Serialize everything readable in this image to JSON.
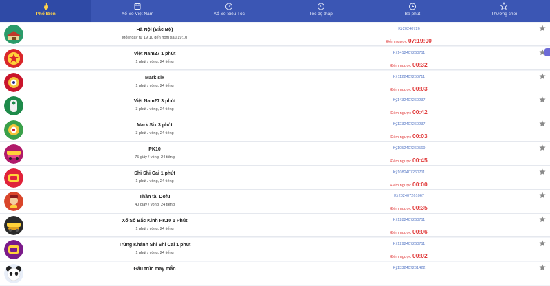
{
  "tabs": [
    {
      "label": "Phổ Biến",
      "icon": "fire-icon",
      "active": true
    },
    {
      "label": "Xổ Số Việt Nam",
      "icon": "calendar-icon",
      "active": false
    },
    {
      "label": "Xổ Số Siêu Tốc",
      "icon": "speedometer-icon",
      "active": false
    },
    {
      "label": "Tốc độ thấp",
      "icon": "gauge-icon",
      "active": false
    },
    {
      "label": "Ba phút",
      "icon": "clock-icon",
      "active": false
    },
    {
      "label": "Thường chơi",
      "icon": "star-icon",
      "active": false
    }
  ],
  "countdown_label": "Đếm ngược",
  "games": [
    {
      "name": "Hà Nội (Bắc Bộ)",
      "schedule": "Mỗi ngày từ 19:10 đến hôm sau 19:10",
      "term": "Kỳ20240726",
      "countdown": "07:19:00",
      "icon": "hanoi-temple-icon"
    },
    {
      "name": "Việt Nam27 1 phút",
      "schedule": "1 phút / vòng, 24 tiếng",
      "term": "Kỳ1412407260711",
      "countdown": "00:32",
      "icon": "vietnam27-icon"
    },
    {
      "name": "Mark six",
      "schedule": "1 phút / vòng, 24 tiếng",
      "term": "Kỳ1122407260711",
      "countdown": "00:03",
      "icon": "mark-six-ball-icon"
    },
    {
      "name": "Việt Nam27 3 phút",
      "schedule": "3 phút / vòng, 24 tiếng",
      "term": "Kỳ1432407260237",
      "countdown": "00:42",
      "icon": "vietnam27-icon"
    },
    {
      "name": "Mark Six 3 phút",
      "schedule": "3 phút / vòng, 24 tiếng",
      "term": "Kỳ1232407260237",
      "countdown": "00:03",
      "icon": "mark-six-ball-icon"
    },
    {
      "name": "PK10",
      "schedule": "75 giây / vòng, 24 tiếng",
      "term": "Kỳ1052407260569",
      "countdown": "00:45",
      "icon": "pk10-car-icon"
    },
    {
      "name": "Shi Shi Cai 1 phút",
      "schedule": "1 phút / vòng, 24 tiếng",
      "term": "Kỳ1082407260711",
      "countdown": "00:00",
      "icon": "shishicai-icon"
    },
    {
      "name": "Thần tài Dofu",
      "schedule": "40 giây / vòng, 24 tiếng",
      "term": "Kỳ202407261067",
      "countdown": "00:35",
      "icon": "god-of-wealth-icon"
    },
    {
      "name": "Xổ Số Bắc Kinh PK10 1 Phút",
      "schedule": "1 phút / vòng, 24 tiếng",
      "term": "Kỳ1282407260711",
      "countdown": "00:06",
      "icon": "pk10-car-icon"
    },
    {
      "name": "Trùng Khánh Shi Shi Cai 1 phút",
      "schedule": "1 phút / vòng, 24 tiếng",
      "term": "Kỳ1292407260711",
      "countdown": "00:02",
      "icon": "shishicai-icon"
    },
    {
      "name": "Gấu trúc may mắn",
      "schedule": "",
      "term": "Kỳ1332407261422",
      "countdown": "",
      "icon": "panda-icon"
    }
  ],
  "colors": {
    "header": "#3b56b4",
    "active_tab_text": "#ffd24a",
    "countdown": "#e03a3a",
    "term": "#5a7bc6"
  }
}
